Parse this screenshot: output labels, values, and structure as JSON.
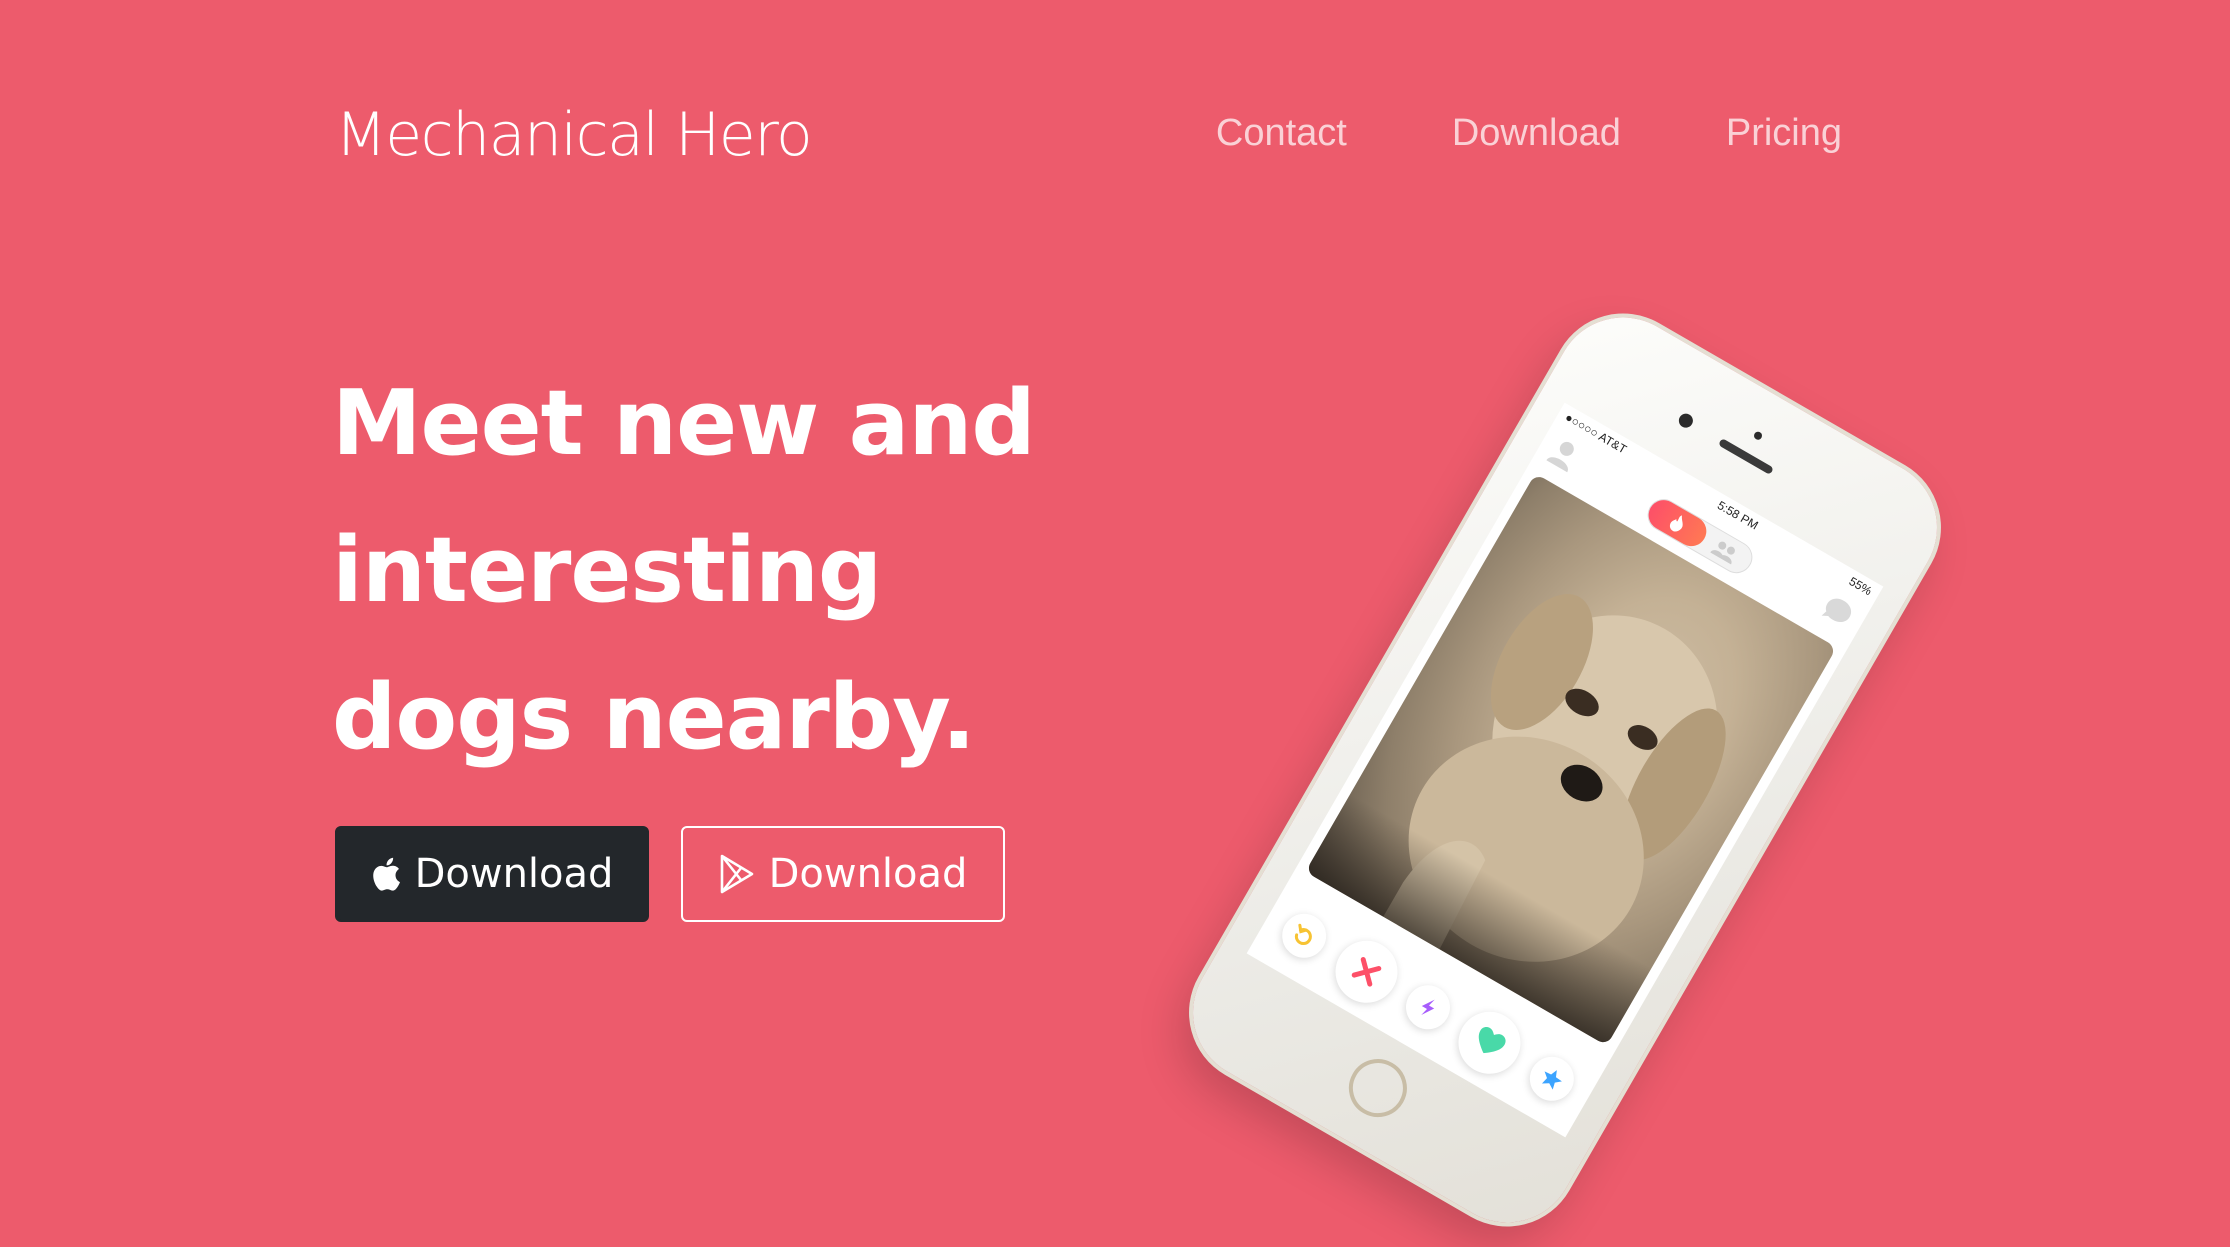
{
  "brand": {
    "name": "Mechanical Hero"
  },
  "nav": {
    "items": [
      {
        "label": "Contact"
      },
      {
        "label": "Download"
      },
      {
        "label": "Pricing"
      }
    ]
  },
  "hero": {
    "headline_lines": [
      "Meet new and",
      "interesting",
      "dogs nearby."
    ],
    "buttons": {
      "apple": {
        "label": "Download",
        "icon": "apple-icon"
      },
      "play": {
        "label": "Download",
        "icon": "play-store-icon"
      }
    }
  },
  "phone": {
    "status": {
      "carrier": "●○○○○ AT&T",
      "time": "5:58 PM",
      "battery": "55%"
    },
    "card_image": "dog-photo",
    "actions": [
      "undo-icon",
      "nope-icon",
      "boost-icon",
      "like-icon",
      "super-like-icon"
    ],
    "colors": {
      "nope": "#fd5068",
      "boost": "#a75dfc",
      "like": "#49d9a8",
      "super_like": "#3ca4ff",
      "undo": "#f7c333"
    }
  },
  "colors": {
    "background": "#ed5b6c",
    "dark_button": "#23272b"
  }
}
